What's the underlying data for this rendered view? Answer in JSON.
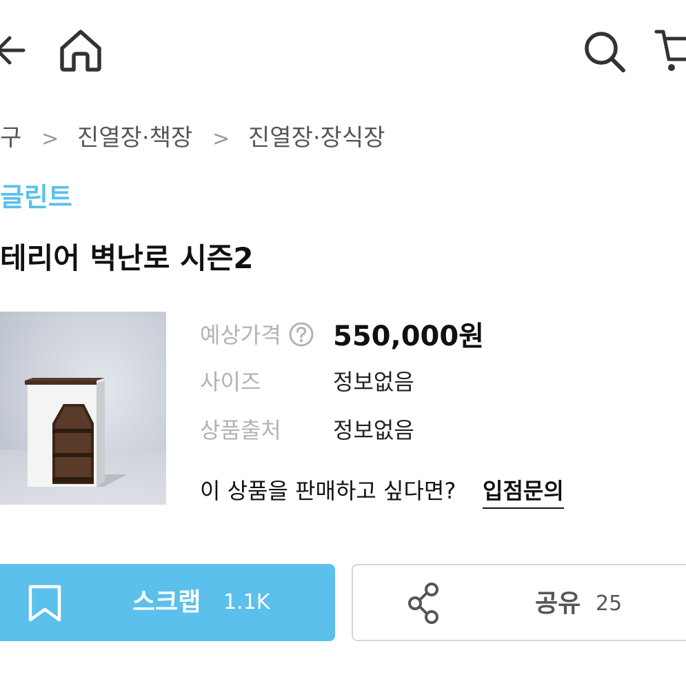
{
  "header": {
    "back_icon": "back-arrow-icon",
    "home_icon": "home-icon",
    "search_icon": "search-icon",
    "cart_icon": "cart-icon"
  },
  "breadcrumb": {
    "items": [
      "구",
      "진열장·책장",
      "진열장·장식장"
    ],
    "separator": ">"
  },
  "product": {
    "brand": "글린트",
    "title": "테리어 벽난로 시즌2",
    "price_label": "예상가격",
    "price": "550,000원",
    "size_label": "사이즈",
    "size_value": "정보없음",
    "origin_label": "상품출처",
    "origin_value": "정보없음",
    "sell_question": "이 상품을 판매하고 싶다면?",
    "sell_link": "입점문의"
  },
  "actions": {
    "scrap_label": "스크랩",
    "scrap_count": "1.1K",
    "share_label": "공유",
    "share_count": "25"
  },
  "colors": {
    "accent": "#5bc0eb",
    "text": "#111111",
    "muted": "#b3b3b3",
    "border": "#d6d6d6"
  }
}
